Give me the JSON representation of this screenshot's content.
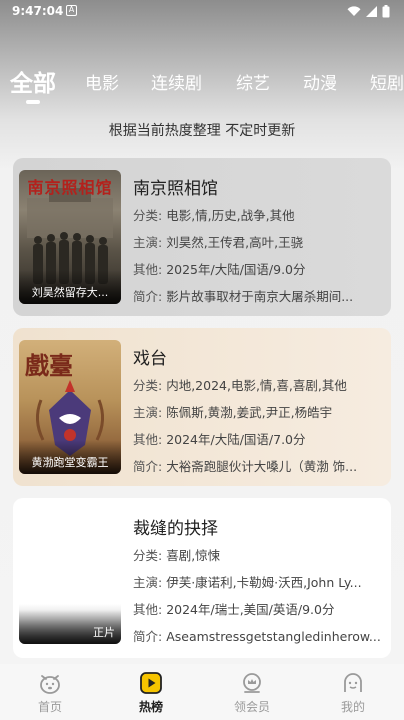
{
  "status": {
    "time": "9:47:04",
    "notif": "A"
  },
  "tabs": [
    "全部",
    "电影",
    "连续剧",
    "综艺",
    "动漫",
    "短剧"
  ],
  "subtitle": "根据当前热度整理 不定时更新",
  "labels": {
    "category": "分类: ",
    "cast": "主演: ",
    "other": "其他: ",
    "intro": "简介: "
  },
  "items": [
    {
      "title": "南京照相馆",
      "poster_title": "南京照相馆",
      "caption": "刘昊然留存大...",
      "category": "电影,情,历史,战争,其他",
      "cast": "刘昊然,王传君,高叶,王骁",
      "other": "2025年/大陆/国语/9.0分",
      "intro": "影片故事取材于南京大屠杀期间..."
    },
    {
      "title": "戏台",
      "poster_title": "戲臺",
      "caption": "黄渤跑堂变霸王",
      "category": "内地,2024,电影,情,喜,喜剧,其他",
      "cast": "陈佩斯,黄渤,姜武,尹正,杨皓宇",
      "other": "2024年/大陆/国语/7.0分",
      "intro": "大裕斋跑腿伙计大嗓儿（黄渤 饰..."
    },
    {
      "title": "裁缝的抉择",
      "caption": "正片",
      "category": "喜剧,惊悚",
      "cast": "伊芙·康诺利,卡勒姆·沃西,John Ly...",
      "other": "2024年/瑞士,美国/英语/9.0分",
      "intro": "Aseamstressgetstangledinherow..."
    }
  ],
  "nav": [
    {
      "label": "首页",
      "icon": "dog-face-icon"
    },
    {
      "label": "热榜",
      "icon": "play-square-icon"
    },
    {
      "label": "领会员",
      "icon": "crown-badge-icon"
    },
    {
      "label": "我的",
      "icon": "face-outline-icon"
    }
  ],
  "colors": {
    "nav_active_icon": "#f6c400",
    "text_dark": "#222222",
    "text_muted": "#9a9a9a"
  }
}
